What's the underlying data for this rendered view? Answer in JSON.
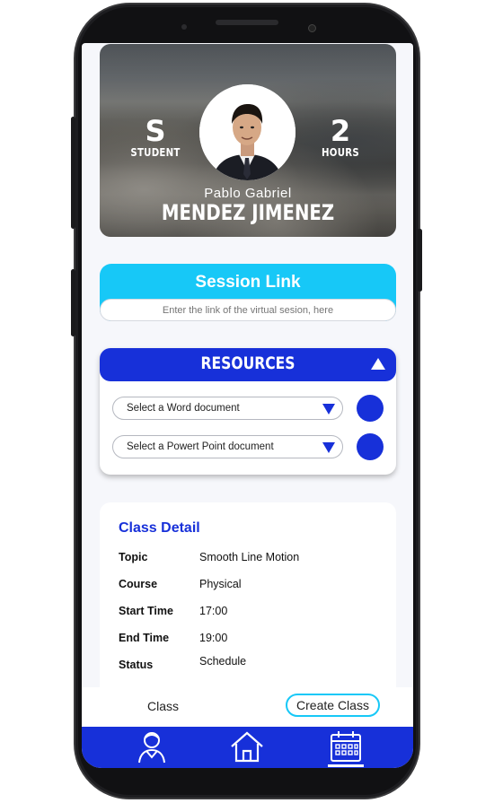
{
  "profile": {
    "students_value": "S",
    "students_label": "STUDENT",
    "hours_value": "2",
    "hours_label": "HOURS",
    "first_name": "Pablo Gabriel",
    "last_name": "MENDEZ JIMENEZ"
  },
  "session": {
    "title": "Session Link",
    "placeholder": "Enter the link of the virtual sesion, here"
  },
  "resources": {
    "title": "RESOURCES",
    "word_select": "Select a Word document",
    "ppt_select": "Select a Powert Point document"
  },
  "class_detail": {
    "title": "Class Detail",
    "rows": [
      {
        "key": "Topic",
        "value": "Smooth Line Motion"
      },
      {
        "key": "Course",
        "value": "Physical"
      },
      {
        "key": "Start Time",
        "value": "17:00"
      },
      {
        "key": "End Time",
        "value": "19:00"
      },
      {
        "key": "Status",
        "value": "Schedule"
      }
    ]
  },
  "tabs": {
    "class_label": "Class",
    "create_label": "Create Class"
  },
  "nav": {
    "items": [
      "user-icon",
      "home-icon",
      "calendar-icon"
    ],
    "active": "calendar-icon"
  },
  "colors": {
    "primary_blue": "#1730d9",
    "accent_cyan": "#17c8f7"
  }
}
